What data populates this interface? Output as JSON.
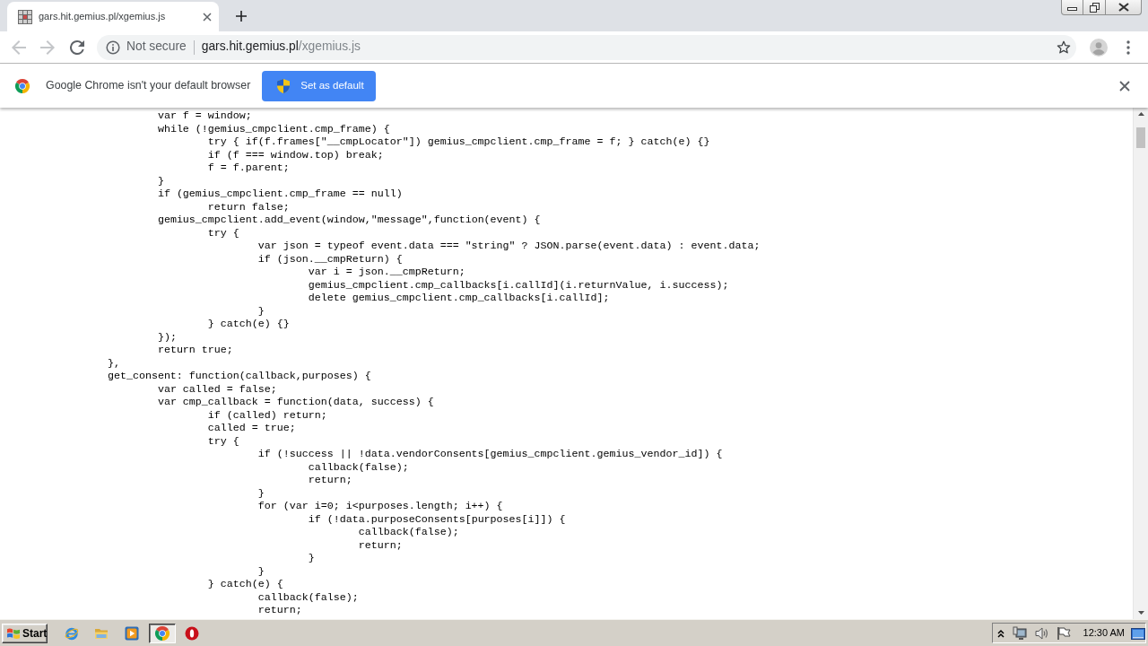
{
  "browser": {
    "tabs": [
      {
        "title": "gars.hit.gemius.pl/xgemius.js",
        "selected": true
      }
    ],
    "toolbar": {
      "back": {
        "disabled": true
      },
      "forward": {
        "disabled": true
      }
    },
    "address_bar": {
      "security_label": "Not secure",
      "host": "gars.hit.gemius.pl",
      "path": "/xgemius.js"
    },
    "infobar": {
      "message": "Google Chrome isn't your default browser",
      "button": "Set as default"
    }
  },
  "page": {
    "code_lines": [
      "\t\t\tvar f = window;",
      "\t\t\twhile (!gemius_cmpclient.cmp_frame) {",
      "\t\t\t\ttry { if(f.frames[\"__cmpLocator\"]) gemius_cmpclient.cmp_frame = f; } catch(e) {}",
      "\t\t\t\tif (f === window.top) break;",
      "\t\t\t\tf = f.parent;",
      "\t\t\t}",
      "\t\t\tif (gemius_cmpclient.cmp_frame == null)",
      "\t\t\t\treturn false;",
      "\t\t\tgemius_cmpclient.add_event(window,\"message\",function(event) {",
      "\t\t\t\ttry {",
      "\t\t\t\t\tvar json = typeof event.data === \"string\" ? JSON.parse(event.data) : event.data;",
      "\t\t\t\t\tif (json.__cmpReturn) {",
      "\t\t\t\t\t\tvar i = json.__cmpReturn;",
      "\t\t\t\t\t\tgemius_cmpclient.cmp_callbacks[i.callId](i.returnValue, i.success);",
      "\t\t\t\t\t\tdelete gemius_cmpclient.cmp_callbacks[i.callId];",
      "\t\t\t\t\t}",
      "\t\t\t\t} catch(e) {}",
      "\t\t\t});",
      "\t\t\treturn true;",
      "\t\t},",
      "\t\tget_consent: function(callback,purposes) {",
      "\t\t\tvar called = false;",
      "\t\t\tvar cmp_callback = function(data, success) {",
      "\t\t\t\tif (called) return;",
      "\t\t\t\tcalled = true;",
      "\t\t\t\ttry {",
      "\t\t\t\t\tif (!success || !data.vendorConsents[gemius_cmpclient.gemius_vendor_id]) {",
      "\t\t\t\t\t\tcallback(false);",
      "\t\t\t\t\t\treturn;",
      "\t\t\t\t\t}",
      "\t\t\t\t\tfor (var i=0; i<purposes.length; i++) {",
      "\t\t\t\t\t\tif (!data.purposeConsents[purposes[i]]) {",
      "\t\t\t\t\t\t\tcallback(false);",
      "\t\t\t\t\t\t\treturn;",
      "\t\t\t\t\t\t}",
      "\t\t\t\t\t}",
      "\t\t\t\t} catch(e) {",
      "\t\t\t\t\tcallback(false);",
      "\t\t\t\t\treturn;"
    ]
  },
  "taskbar": {
    "start": "Start",
    "tasks": [
      {
        "kind": "browser",
        "selected": true
      },
      {
        "kind": "ring",
        "selected": false
      }
    ],
    "clock": "12:30 AM"
  }
}
